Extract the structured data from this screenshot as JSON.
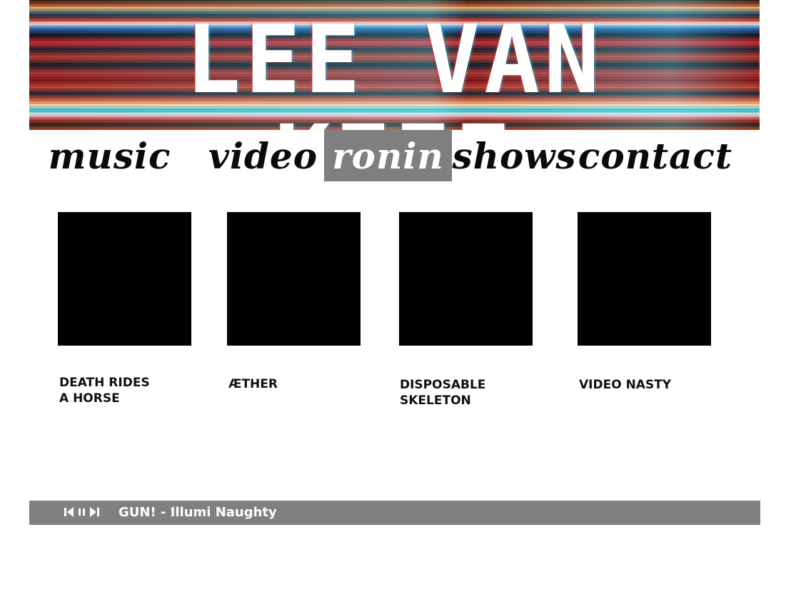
{
  "header": {
    "title": "LEE VAN KEEF"
  },
  "nav": {
    "items": [
      {
        "label": "music",
        "active": false
      },
      {
        "label": "video",
        "active": false
      },
      {
        "label": "ronin",
        "active": true
      },
      {
        "label": "shows",
        "active": false
      },
      {
        "label": "contact",
        "active": false
      }
    ]
  },
  "albums": [
    {
      "title": "DEATH RIDES A HORSE",
      "lines": [
        "DEATH RIDES",
        "A HORSE"
      ]
    },
    {
      "title": "ÆTHER",
      "lines": [
        "ÆTHER"
      ]
    },
    {
      "title": "DISPOSABLE SKELETON",
      "lines": [
        "DISPOSABLE",
        "SKELETON"
      ]
    },
    {
      "title": "VIDEO NASTY",
      "lines": [
        "VIDEO NASTY"
      ]
    }
  ],
  "player": {
    "track": "GUN! - Illumi Naughty",
    "controls": {
      "prev_icon": "prev-icon",
      "pause_icon": "pause-icon",
      "next_icon": "next-icon"
    },
    "bar_color": "#808080"
  },
  "colors": {
    "nav_active_bg": "#7f7f7f",
    "cover_bg": "#000000"
  }
}
